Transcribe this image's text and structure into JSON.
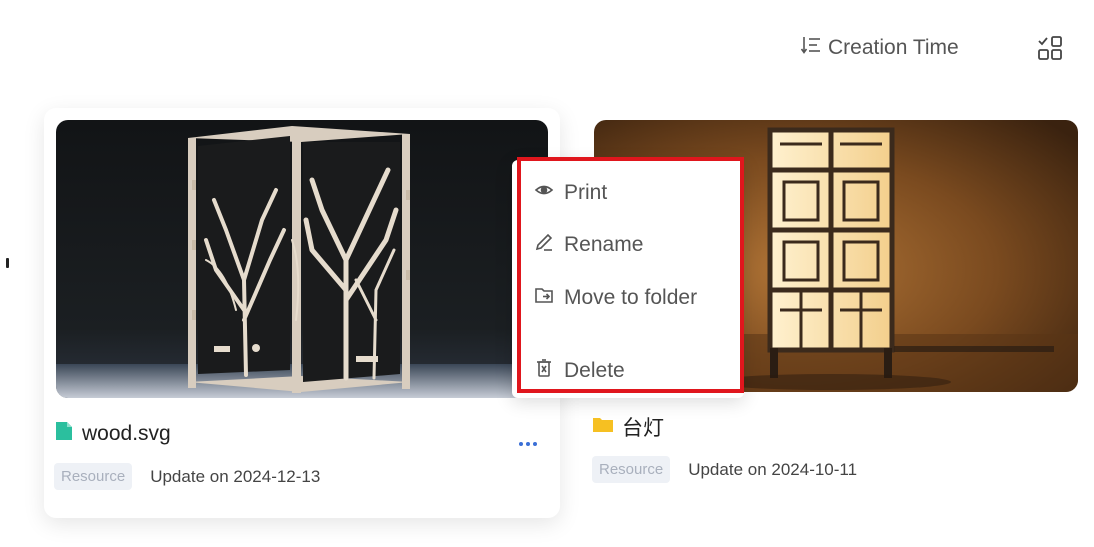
{
  "toolbar": {
    "sort_label": "Creation Time",
    "sort_icon": "sort-descending-icon",
    "view_toggle_icon": "grid-view-icon"
  },
  "cards": [
    {
      "name": "wood.svg",
      "file_icon": "file-icon",
      "file_icon_color": "#2bbf9e",
      "badge": "Resource",
      "updated": "Update on 2024-12-13",
      "more_icon": "more-dots-icon",
      "thumbnail": "laser-cut wooden tree box"
    },
    {
      "name": "台灯",
      "file_icon": "folder-icon",
      "file_icon_color": "#f6c022",
      "badge": "Resource",
      "updated": "Update on 2024-10-11",
      "thumbnail": "wooden lattice table lamp"
    }
  ],
  "context_menu": {
    "items": [
      {
        "label": "Print",
        "icon": "eye-icon"
      },
      {
        "label": "Rename",
        "icon": "pencil-icon"
      },
      {
        "label": "Move to folder",
        "icon": "folder-move-icon"
      },
      {
        "label": "Delete",
        "icon": "trash-icon"
      }
    ],
    "highlight_color": "#e0161d"
  },
  "colors": {
    "accent": "#3b6fd6",
    "badge_bg": "#eef1f6",
    "badge_text": "#a9b0bd"
  }
}
